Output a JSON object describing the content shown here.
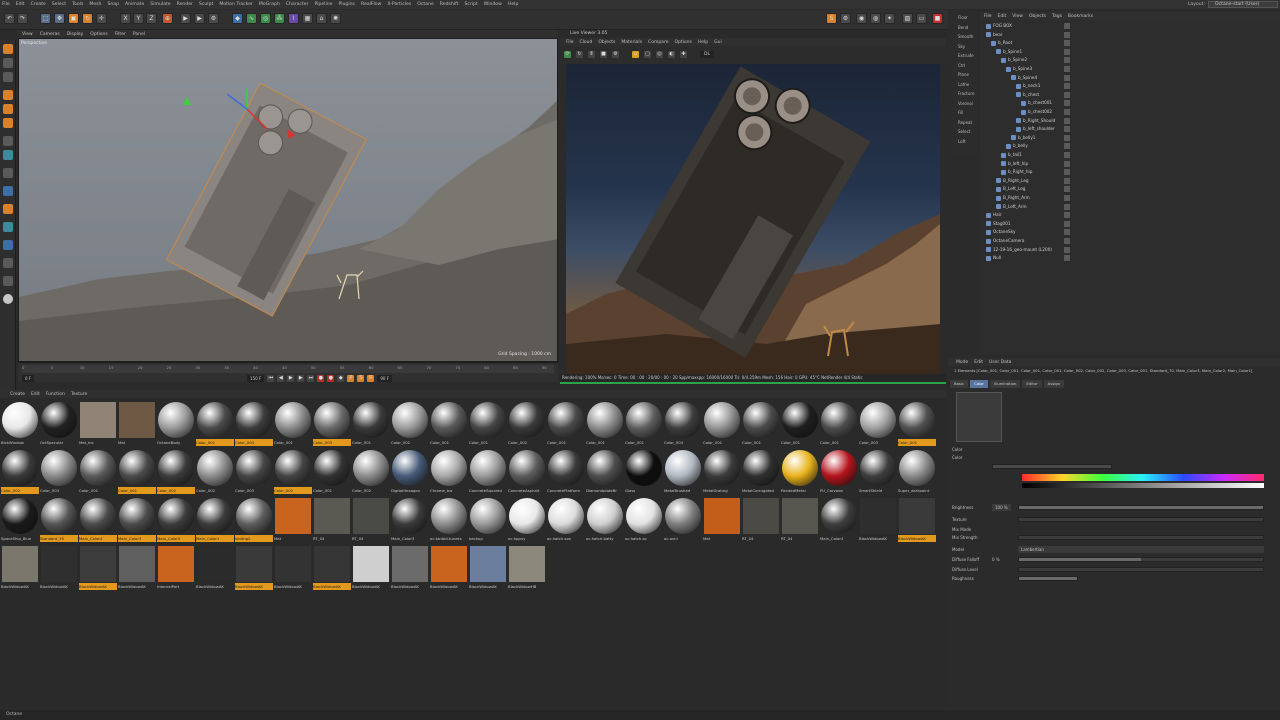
{
  "menubar": [
    "File",
    "Edit",
    "Create",
    "Select",
    "Tools",
    "Mesh",
    "Snap",
    "Animate",
    "Simulate",
    "Render",
    "Sculpt",
    "Motion Tracker",
    "MoGraph",
    "Character",
    "Pipeline",
    "Plugins",
    "RealFlow",
    "X-Particles",
    "Octane",
    "Redshift",
    "Script",
    "Window",
    "Help"
  ],
  "layout": {
    "label": "Layout:",
    "value": "Octane-start (User)"
  },
  "viewport": {
    "menu": [
      "View",
      "Cameras",
      "Display",
      "Options",
      "Filter",
      "Panel"
    ],
    "label": "Perspective",
    "grid_spacing": "Grid Spacing : 1000 cm"
  },
  "timeline": {
    "ticks": [
      "0",
      "5",
      "10",
      "15",
      "20",
      "25",
      "30",
      "35",
      "40",
      "45",
      "50",
      "55",
      "60",
      "65",
      "70",
      "75",
      "80",
      "85",
      "90"
    ],
    "current_frame": "0 F",
    "end_frame": "150 F",
    "frame_field": "90 F"
  },
  "live_viewer": {
    "title": "Live Viewer 3.05",
    "menu": [
      "File",
      "Cloud",
      "Objects",
      "Materials",
      "Compare",
      "Options",
      "Help",
      "Gui"
    ],
    "channel": "DL",
    "status": "Rendering: 100%  Ms/sec: 0  Time: 00 : 00 : 20/00 : 00 : 20  Spp/maxspp: 16000/16000  Tri: 0/4.259m  Mesh: 156  Hair: 0    GPU:  45°C  NetRender 4/4   Static"
  },
  "materials": {
    "menu": [
      "Create",
      "Edit",
      "Function",
      "Texture"
    ],
    "items": [
      {
        "label": "BlckWindow",
        "kind": "ball",
        "color": "#e8e8e8",
        "hl": false
      },
      {
        "label": "OctSpecular",
        "kind": "ball",
        "color": "#222222",
        "hl": false
      },
      {
        "label": "Mat_Ins",
        "kind": "sq",
        "color": "#8f8476",
        "hl": false
      },
      {
        "label": "Mat",
        "kind": "sq",
        "color": "#6e5a44",
        "hl": false
      },
      {
        "label": "OctaneBody",
        "kind": "ball",
        "color": "#9a9a9a",
        "hl": false
      },
      {
        "label": "Color_001",
        "kind": "ball",
        "color": "#4a4a4a",
        "hl": true
      },
      {
        "label": "Color_004",
        "kind": "ball",
        "color": "#3c3c3c",
        "hl": true
      },
      {
        "label": "Color_001",
        "kind": "ball",
        "color": "#8a8a8a",
        "hl": false
      },
      {
        "label": "Color_003",
        "kind": "ball",
        "color": "#6a6a6a",
        "hl": true
      },
      {
        "label": "Color_001",
        "kind": "ball",
        "color": "#3a3a3a",
        "hl": false
      },
      {
        "label": "Color_002",
        "kind": "ball",
        "color": "#9b9b9b",
        "hl": false
      },
      {
        "label": "Color_001",
        "kind": "ball",
        "color": "#5a5a5a",
        "hl": false
      },
      {
        "label": "Color_001",
        "kind": "ball",
        "color": "#454545",
        "hl": false
      },
      {
        "label": "Color_002",
        "kind": "ball",
        "color": "#3a3a3a",
        "hl": false
      },
      {
        "label": "Color_001",
        "kind": "ball",
        "color": "#4a4a4a",
        "hl": false
      },
      {
        "label": "Color_001",
        "kind": "ball",
        "color": "#8c8c8c",
        "hl": false
      },
      {
        "label": "Color_001",
        "kind": "ball",
        "color": "#5e5e5e",
        "hl": false
      },
      {
        "label": "Color_004",
        "kind": "ball",
        "color": "#3e3e3e",
        "hl": false
      },
      {
        "label": "Color_001",
        "kind": "ball",
        "color": "#939393",
        "hl": false
      },
      {
        "label": "Color_001",
        "kind": "ball",
        "color": "#4b4b4b",
        "hl": false
      },
      {
        "label": "Color_001",
        "kind": "ball",
        "color": "#1f1f1f",
        "hl": false
      },
      {
        "label": "Color_001",
        "kind": "ball",
        "color": "#4c4c4c",
        "hl": false
      },
      {
        "label": "Color_003",
        "kind": "ball",
        "color": "#a0a0a0",
        "hl": false
      },
      {
        "label": "Color_001",
        "kind": "ball",
        "color": "#505050",
        "hl": true
      },
      {
        "label": "Color_002",
        "kind": "ball",
        "color": "#3a3a3a",
        "hl": true
      },
      {
        "label": "Color_003",
        "kind": "ball",
        "color": "#8a8a8a",
        "hl": false
      },
      {
        "label": "Color_001",
        "kind": "ball",
        "color": "#5a5a5a",
        "hl": false
      },
      {
        "label": "Color_001",
        "kind": "ball",
        "color": "#4a4a4a",
        "hl": true
      },
      {
        "label": "Color_002",
        "kind": "ball",
        "color": "#3b3b3b",
        "hl": true
      },
      {
        "label": "Color_002",
        "kind": "ball",
        "color": "#8c8c8c",
        "hl": false
      },
      {
        "label": "Color_003",
        "kind": "ball",
        "color": "#454545",
        "hl": false
      },
      {
        "label": "Color_002",
        "kind": "ball",
        "color": "#444444",
        "hl": true
      },
      {
        "label": "Color_001",
        "kind": "ball",
        "color": "#333333",
        "hl": false
      },
      {
        "label": "Color_002",
        "kind": "ball",
        "color": "#8c8c8c",
        "hl": false
      },
      {
        "label": "DigitalHexagon",
        "kind": "ball",
        "color": "#465a78",
        "hl": false
      },
      {
        "label": "Chrome_bw",
        "kind": "ball",
        "color": "#a7a7a7",
        "hl": false
      },
      {
        "label": "ConcreteSquared",
        "kind": "ball",
        "color": "#9a9a9a",
        "hl": false
      },
      {
        "label": "ConcreteAsphalt",
        "kind": "ball",
        "color": "#5c5c5c",
        "hl": false
      },
      {
        "label": "ConcretePlatform",
        "kind": "ball",
        "color": "#3a3a3a",
        "hl": false
      },
      {
        "label": "DiamondplateBr",
        "kind": "ball",
        "color": "#4d4d4d",
        "hl": false
      },
      {
        "label": "Glass",
        "kind": "ball",
        "color": "#0e0e0e",
        "hl": false
      },
      {
        "label": "MetalBrushed",
        "kind": "ball",
        "color": "#b0b8c2",
        "hl": false
      },
      {
        "label": "MetalGrating",
        "kind": "ball",
        "color": "#3b3b3b",
        "hl": false
      },
      {
        "label": "MetalCorrugated",
        "kind": "ball",
        "color": "#2f2f2f",
        "hl": false
      },
      {
        "label": "PaintedMetal",
        "kind": "ball",
        "color": "#e8b21c",
        "hl": false
      },
      {
        "label": "PU_Carvado",
        "kind": "ball",
        "color": "#b4141c",
        "hl": false
      },
      {
        "label": "SmartShield",
        "kind": "ball",
        "color": "#3e3e3e",
        "hl": false
      },
      {
        "label": "Super_darkpaint",
        "kind": "ball",
        "color": "#8a8a8a",
        "hl": false
      },
      {
        "label": "SpaceShip_Blue",
        "kind": "ball",
        "color": "#1b1b1b",
        "hl": false
      },
      {
        "label": "Standard_35",
        "kind": "ball",
        "color": "#555555",
        "hl": true
      },
      {
        "label": "Main_Color4",
        "kind": "ball",
        "color": "#4a4a4a",
        "hl": true
      },
      {
        "label": "Main_Color3",
        "kind": "ball",
        "color": "#4c4c4c",
        "hl": true
      },
      {
        "label": "Main_Color5",
        "kind": "ball",
        "color": "#3c3c3c",
        "hl": true
      },
      {
        "label": "Main_Color1",
        "kind": "ball",
        "color": "#3c3c3c",
        "hl": true
      },
      {
        "label": "shotng2",
        "kind": "ball",
        "color": "#5e5e5e",
        "hl": true
      },
      {
        "label": "Mat",
        "kind": "sq",
        "color": "#c9641e",
        "hl": false
      },
      {
        "label": "RT_04",
        "kind": "sq",
        "color": "#5b5a52",
        "hl": false
      },
      {
        "label": "RT_04",
        "kind": "sq",
        "color": "#4a4a46",
        "hl": false
      },
      {
        "label": "Main_Color3",
        "kind": "ball",
        "color": "#3a3a3a",
        "hl": false
      },
      {
        "label": "oc.tanbld.tuneks",
        "kind": "ball",
        "color": "#8d8d8d",
        "hl": false
      },
      {
        "label": "backup",
        "kind": "ball",
        "color": "#9a9a9a",
        "hl": false
      },
      {
        "label": "oc.hppvy",
        "kind": "ball",
        "color": "#e8e8e8",
        "hl": false
      },
      {
        "label": "oc.hatch.sos",
        "kind": "ball",
        "color": "#dcdcdc",
        "hl": false
      },
      {
        "label": "oc.hatch.batty",
        "kind": "ball",
        "color": "#cfcfcf",
        "hl": false
      },
      {
        "label": "oc.hatch.oc",
        "kind": "ball",
        "color": "#e2e2e2",
        "hl": false
      },
      {
        "label": "oc.ovnl",
        "kind": "ball",
        "color": "#7e7e7e",
        "hl": false
      },
      {
        "label": "Mat",
        "kind": "sq",
        "color": "#c25e1a",
        "hl": false
      },
      {
        "label": "RT_04",
        "kind": "sq",
        "color": "#4b4a44",
        "hl": false
      },
      {
        "label": "RT_04",
        "kind": "sq",
        "color": "#56554e",
        "hl": false
      },
      {
        "label": "Main_Color4",
        "kind": "ball",
        "color": "#3e3e3e",
        "hl": false
      },
      {
        "label": "BlackWidowAK",
        "kind": "sq",
        "color": "#2e2e2e",
        "hl": false
      },
      {
        "label": "BlackWidowAK",
        "kind": "sq",
        "color": "#3a3a3a",
        "hl": true
      },
      {
        "label": "BlackWidowAK",
        "kind": "sq",
        "color": "#7a776c",
        "hl": false
      },
      {
        "label": "BlackWidowAK",
        "kind": "sq",
        "color": "#2f2f2f",
        "hl": false
      },
      {
        "label": "BlackWidowAK",
        "kind": "sq",
        "color": "#3c3c3c",
        "hl": true
      },
      {
        "label": "BlackWidowAK",
        "kind": "sq",
        "color": "#5f5f5f",
        "hl": false
      },
      {
        "label": "InternalPart",
        "kind": "sq",
        "color": "#c9641e",
        "hl": false
      },
      {
        "label": "BlackWidowAK",
        "kind": "sq",
        "color": "#2b2b2b",
        "hl": false
      },
      {
        "label": "BlackWidowAK",
        "kind": "sq",
        "color": "#3a3a3a",
        "hl": true
      },
      {
        "label": "BlackWidowAK",
        "kind": "sq",
        "color": "#333333",
        "hl": false
      },
      {
        "label": "BlackWidowAK",
        "kind": "sq",
        "color": "#363636",
        "hl": true
      },
      {
        "label": "BlackWidowAK",
        "kind": "sq",
        "color": "#cfcfcf",
        "hl": false
      },
      {
        "label": "BlackWidowAK",
        "kind": "sq",
        "color": "#6b6b6b",
        "hl": false
      },
      {
        "label": "BlackWidowAK",
        "kind": "sq",
        "color": "#c9641e",
        "hl": false
      },
      {
        "label": "BlackWidowAK",
        "kind": "sq",
        "color": "#6b7e9e",
        "hl": false
      },
      {
        "label": "BlackWidowHB",
        "kind": "sq",
        "color": "#8b877a",
        "hl": false
      }
    ]
  },
  "right_tools": [
    "Floor",
    "Bend",
    "Smooth",
    "Sky",
    "Extrude",
    "Ctrl",
    "Plane",
    "Lathe",
    "Fracture",
    "Voronoi",
    "Fill",
    "Repeat",
    "Select",
    "Loft"
  ],
  "objects": {
    "menu": [
      "File",
      "Edit",
      "View",
      "Objects",
      "Tags",
      "Bookmarks"
    ],
    "items": [
      {
        "label": "FOG BOX",
        "depth": 0
      },
      {
        "label": "bear",
        "depth": 0
      },
      {
        "label": "b_Root",
        "depth": 1
      },
      {
        "label": "b_Spine1",
        "depth": 2
      },
      {
        "label": "b_Spine2",
        "depth": 3
      },
      {
        "label": "b_Spine3",
        "depth": 4
      },
      {
        "label": "b_Spine4",
        "depth": 5
      },
      {
        "label": "b_neck1",
        "depth": 6
      },
      {
        "label": "b_chest",
        "depth": 6
      },
      {
        "label": "b_chest001",
        "depth": 7
      },
      {
        "label": "b_chest002",
        "depth": 7
      },
      {
        "label": "b_Right_Should",
        "depth": 6
      },
      {
        "label": "b_left_shoulder",
        "depth": 6
      },
      {
        "label": "b_belly1",
        "depth": 5
      },
      {
        "label": "b_belly",
        "depth": 4
      },
      {
        "label": "b_tail1",
        "depth": 3
      },
      {
        "label": "b_left_hip",
        "depth": 3
      },
      {
        "label": "b_Right_hip",
        "depth": 3
      },
      {
        "label": "B_Right_Leg",
        "depth": 2
      },
      {
        "label": "B_Left_Leg",
        "depth": 2
      },
      {
        "label": "B_Right_Arm",
        "depth": 2
      },
      {
        "label": "B_Left_Arm",
        "depth": 2
      },
      {
        "label": "Hair",
        "depth": 0
      },
      {
        "label": "Stag001",
        "depth": 0
      },
      {
        "label": "OctaneSky",
        "depth": 0
      },
      {
        "label": "OctaneCamera",
        "depth": 0
      },
      {
        "label": "12-19-16_geo-mount (L200)",
        "depth": 0
      },
      {
        "label": "Null",
        "depth": 0
      }
    ]
  },
  "attributes": {
    "menu": [
      "Mode",
      "Edit",
      "User Data"
    ],
    "info": "1 Elements [Color_001, Color_001, Color_001, Color_001, Color_002, Color_002, Color_003, Color_001, Standard_70, Main_Color3, Main_Color2, Main_Color1]",
    "tabs": [
      "Basic",
      "Color",
      "Illumination",
      "Editor",
      "Assign"
    ],
    "active_tab": "Color",
    "section": "Color",
    "color_label": "Color",
    "rows": {
      "brightness": {
        "label": "Brightness",
        "value": "100 %"
      },
      "texture": "Texture",
      "mix_mode": "Mix Mode",
      "mix_strength": "Mix Strength",
      "model": {
        "label": "Model",
        "value": "Lambertian"
      },
      "diffuse_falloff": {
        "label": "Diffuse Falloff",
        "value": "0 %"
      },
      "diffuse_level": "Diffuse Level",
      "roughness": "Roughness"
    }
  },
  "statusbar": "Octane"
}
